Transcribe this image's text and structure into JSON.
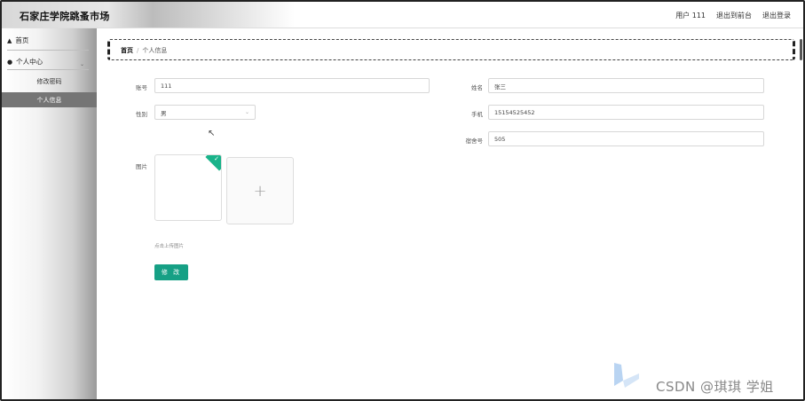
{
  "header": {
    "brand": "石家庄学院跳蚤市场",
    "user_label": "用户 111",
    "back_frontend": "退出到前台",
    "logout": "退出登录"
  },
  "sidebar": {
    "home": "首页",
    "personal_center": "个人中心",
    "sub_items": [
      {
        "label": "修改密码"
      },
      {
        "label": "个人信息",
        "active": true
      }
    ]
  },
  "breadcrumb": {
    "home": "首页",
    "separator": "/",
    "current": "个人信息"
  },
  "form": {
    "account_label": "账号",
    "account_value": "111",
    "name_label": "姓名",
    "name_value": "张三",
    "gender_label": "性别",
    "gender_value": "男",
    "phone_label": "手机",
    "phone_value": "15154525452",
    "dorm_label": "宿舍号",
    "dorm_value": "505",
    "image_label": "图片",
    "upload_plus": "+",
    "upload_hint": "点击上传图片",
    "submit_label": "修 改"
  },
  "watermark": {
    "text": "CSDN @琪琪 学姐"
  },
  "colors": {
    "primary": "#16a085",
    "active_menu": "#757575"
  }
}
